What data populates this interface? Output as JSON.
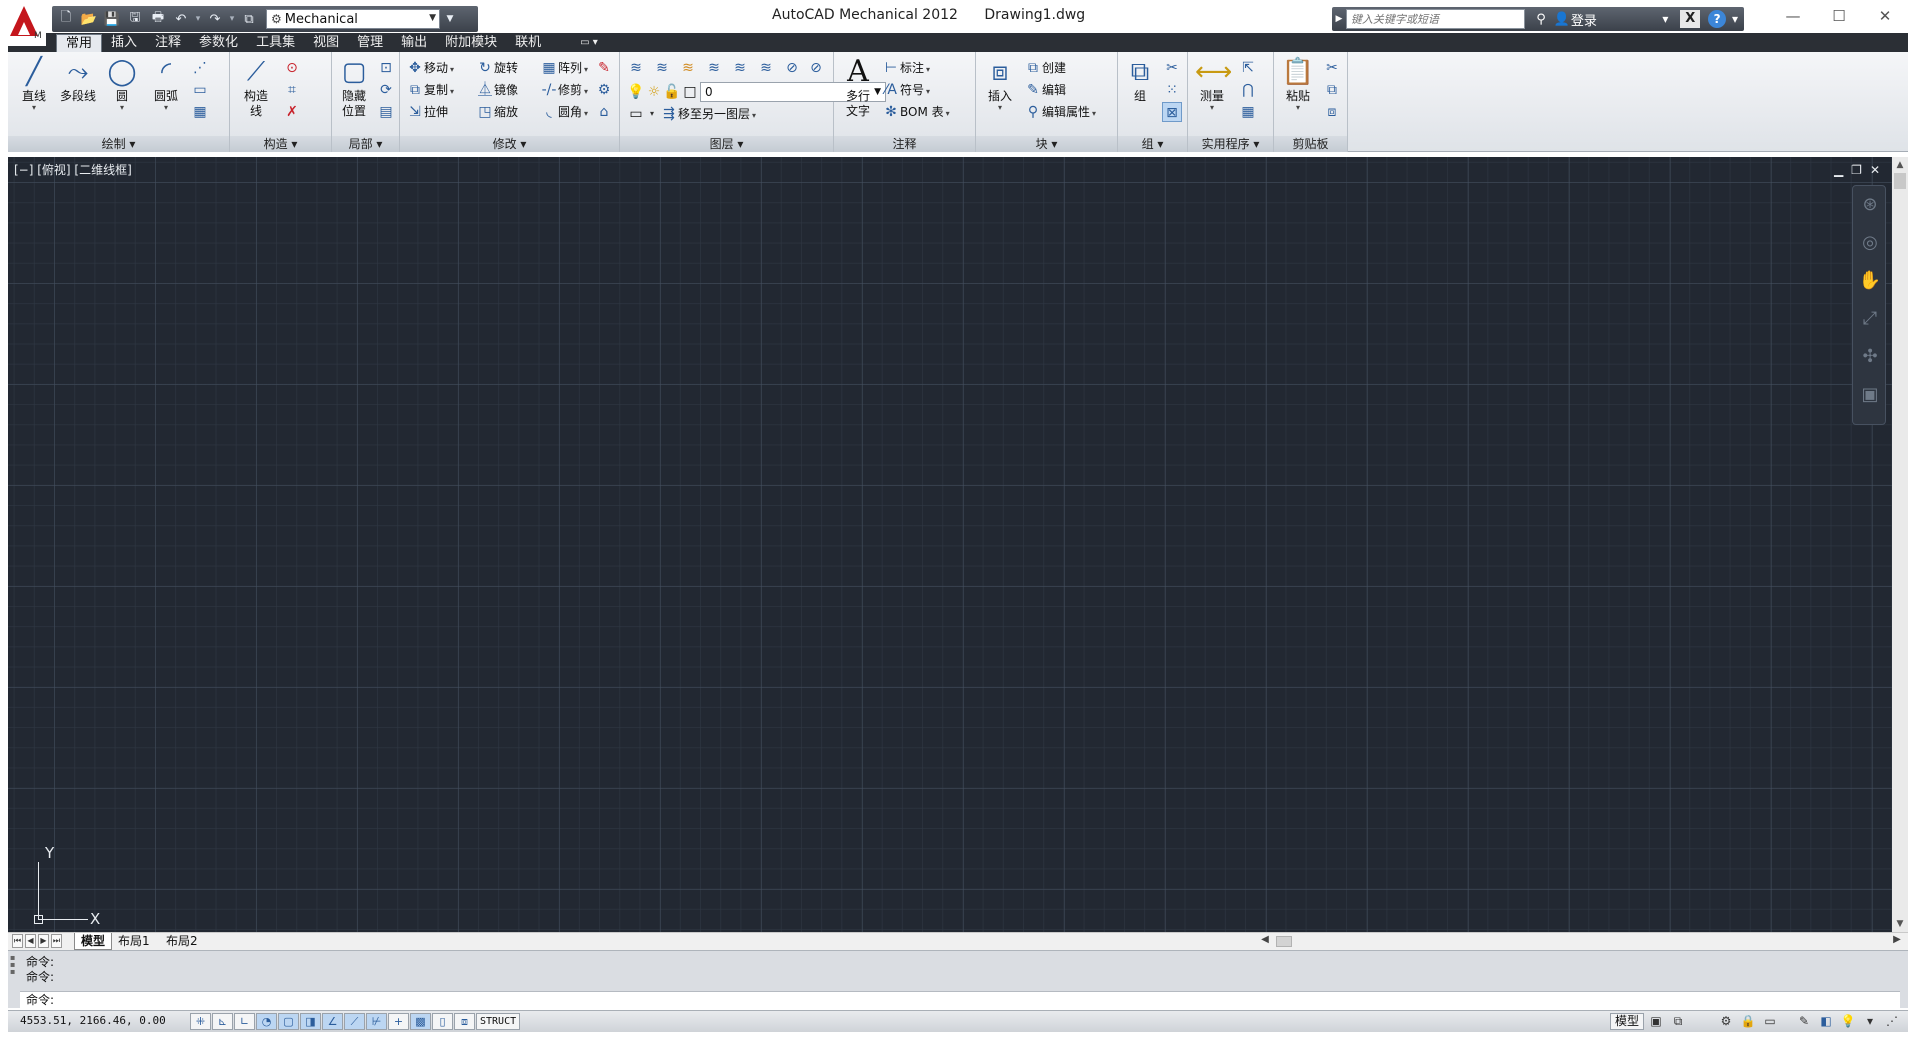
{
  "titlebar": {
    "app_title": "AutoCAD Mechanical 2012",
    "document": "Drawing1.dwg",
    "workspace": "Mechanical",
    "search_placeholder": "键入关键字或短语",
    "signin": "登录",
    "help": "?"
  },
  "ribbon_tabs": [
    "常用",
    "插入",
    "注释",
    "参数化",
    "工具集",
    "视图",
    "管理",
    "输出",
    "附加模块",
    "联机"
  ],
  "ribbon": {
    "draw": {
      "title": "绘制 ▾",
      "line": "直线",
      "polyline": "多段线",
      "circle": "圆",
      "arc": "圆弧"
    },
    "construct": {
      "title": "构造 ▾",
      "line_a": "构造",
      "line_b": "线"
    },
    "local": {
      "title": "局部 ▾",
      "hide_a": "隐藏",
      "hide_b": "位置"
    },
    "modify": {
      "title": "修改 ▾",
      "move": "移动",
      "rotate": "旋转",
      "array": "阵列",
      "copy": "复制",
      "mirror": "镜像",
      "trim": "修剪",
      "stretch": "拉伸",
      "scale": "缩放",
      "fillet": "圆角"
    },
    "layers": {
      "title": "图层 ▾",
      "current_layer": "0",
      "move_to_layer": "移至另一图层"
    },
    "annotation": {
      "title": "注释",
      "mtext_a": "多行",
      "mtext_b": "文字",
      "dimension": "标注",
      "symbol": "符号",
      "bom": "BOM 表"
    },
    "block": {
      "title": "块 ▾",
      "insert": "插入",
      "create": "创建",
      "edit": "编辑",
      "edit_attr": "编辑属性"
    },
    "group": {
      "title": "组 ▾",
      "group": "组"
    },
    "utilities": {
      "title": "实用程序 ▾",
      "measure": "测量"
    },
    "clipboard": {
      "title": "剪贴板",
      "paste": "粘贴"
    }
  },
  "viewport": {
    "label": "[−] [俯视] [二维线框]",
    "x_axis": "X",
    "y_axis": "Y"
  },
  "layout_tabs": [
    "模型",
    "布局1",
    "布局2"
  ],
  "command": {
    "history": [
      "命令:",
      "命令:"
    ],
    "prompt": "命令:"
  },
  "status": {
    "coordinates": "4553.51,  2166.46,  0.00",
    "struct_label": "STRUCT",
    "model_label": "模型"
  }
}
